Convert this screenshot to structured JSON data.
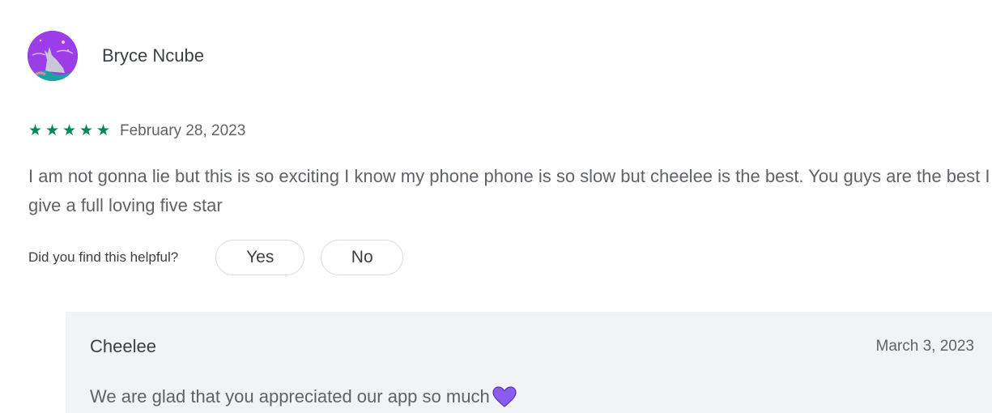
{
  "review": {
    "author": "Bryce Ncube",
    "avatar_icon": "wolf-avatar-icon",
    "rating": 5,
    "rating_max": 5,
    "star_color": "#01875f",
    "stars": [
      "★",
      "★",
      "★",
      "★",
      "★"
    ],
    "date": "February 28, 2023",
    "text": "I am not gonna lie but this is so exciting I know my phone phone is so slow but cheelee is the best. You guys are the best I give a full loving five star"
  },
  "helpful": {
    "question": "Did you find this helpful?",
    "yes_label": "Yes",
    "no_label": "No"
  },
  "reply": {
    "author": "Cheelee",
    "date": "March 3, 2023",
    "text": "We are glad that you appreciated our app so much",
    "trailing_icon": "purple-heart-icon",
    "background": "#f1f3f4"
  }
}
